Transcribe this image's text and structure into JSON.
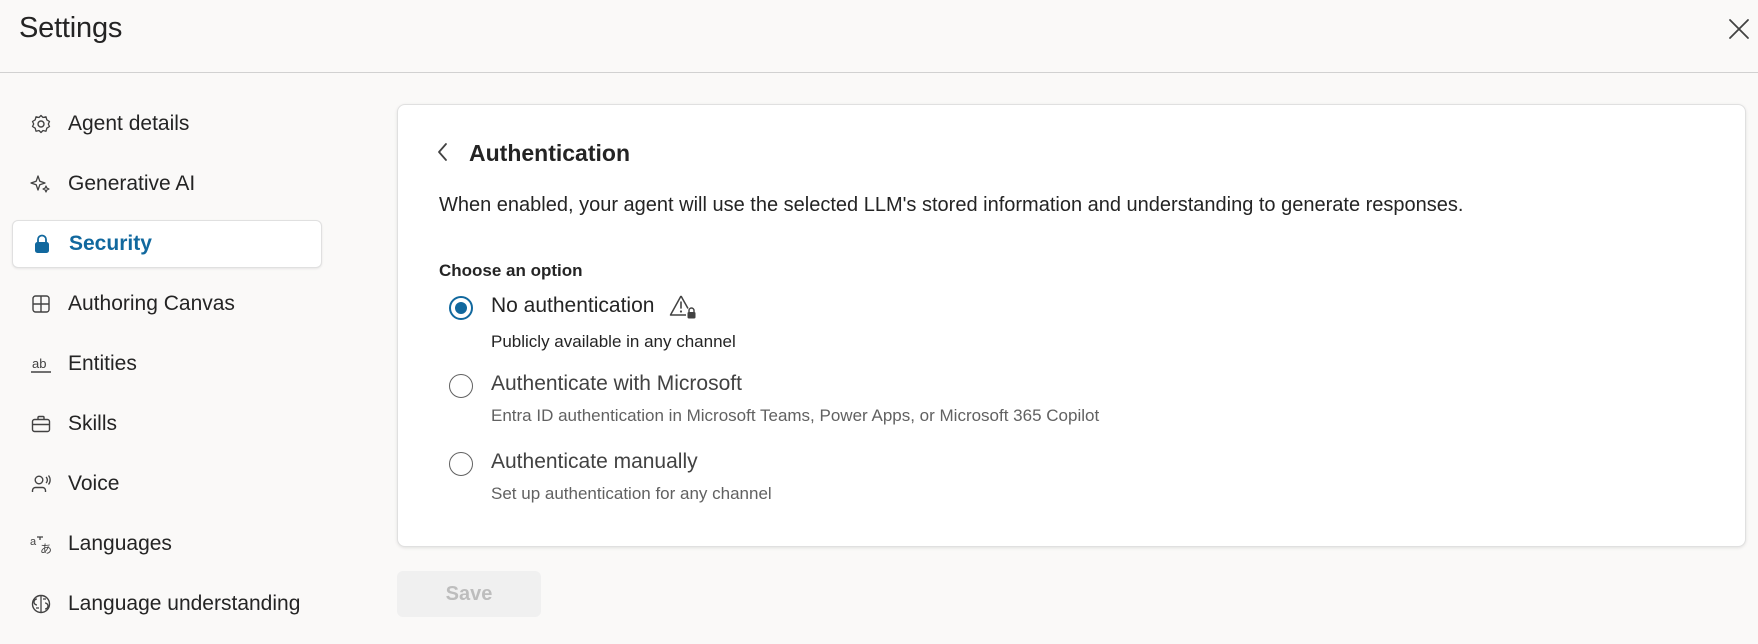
{
  "header": {
    "title": "Settings",
    "close_icon": "close-icon"
  },
  "sidebar": {
    "items": [
      {
        "label": "Agent details",
        "icon": "gear-icon",
        "active": false
      },
      {
        "label": "Generative AI",
        "icon": "sparkle-icon",
        "active": false
      },
      {
        "label": "Security",
        "icon": "lock-icon",
        "active": true
      },
      {
        "label": "Authoring Canvas",
        "icon": "grid-icon",
        "active": false
      },
      {
        "label": "Entities",
        "icon": "ab-text-icon",
        "active": false
      },
      {
        "label": "Skills",
        "icon": "briefcase-icon",
        "active": false
      },
      {
        "label": "Voice",
        "icon": "person-voice-icon",
        "active": false
      },
      {
        "label": "Languages",
        "icon": "translate-icon",
        "active": false
      },
      {
        "label": "Language understanding",
        "icon": "brain-icon",
        "active": false
      }
    ]
  },
  "panel": {
    "back_icon": "chevron-left-icon",
    "title": "Authentication",
    "description": "When enabled, your agent will use the selected LLM's stored information and understanding to generate responses.",
    "choose_label": "Choose an option",
    "options": [
      {
        "label": "No authentication",
        "sub": "Publicly available in any channel",
        "selected": true,
        "icon": "warning-lock-icon"
      },
      {
        "label": "Authenticate with Microsoft",
        "sub": "Entra ID authentication in Microsoft Teams, Power Apps, or Microsoft 365 Copilot",
        "selected": false
      },
      {
        "label": "Authenticate manually",
        "sub": "Set up authentication for any channel",
        "selected": false
      }
    ]
  },
  "footer": {
    "save_label": "Save",
    "save_disabled": true
  },
  "colors": {
    "accent": "#11689e",
    "background": "#faf9f8",
    "card": "#ffffff"
  }
}
